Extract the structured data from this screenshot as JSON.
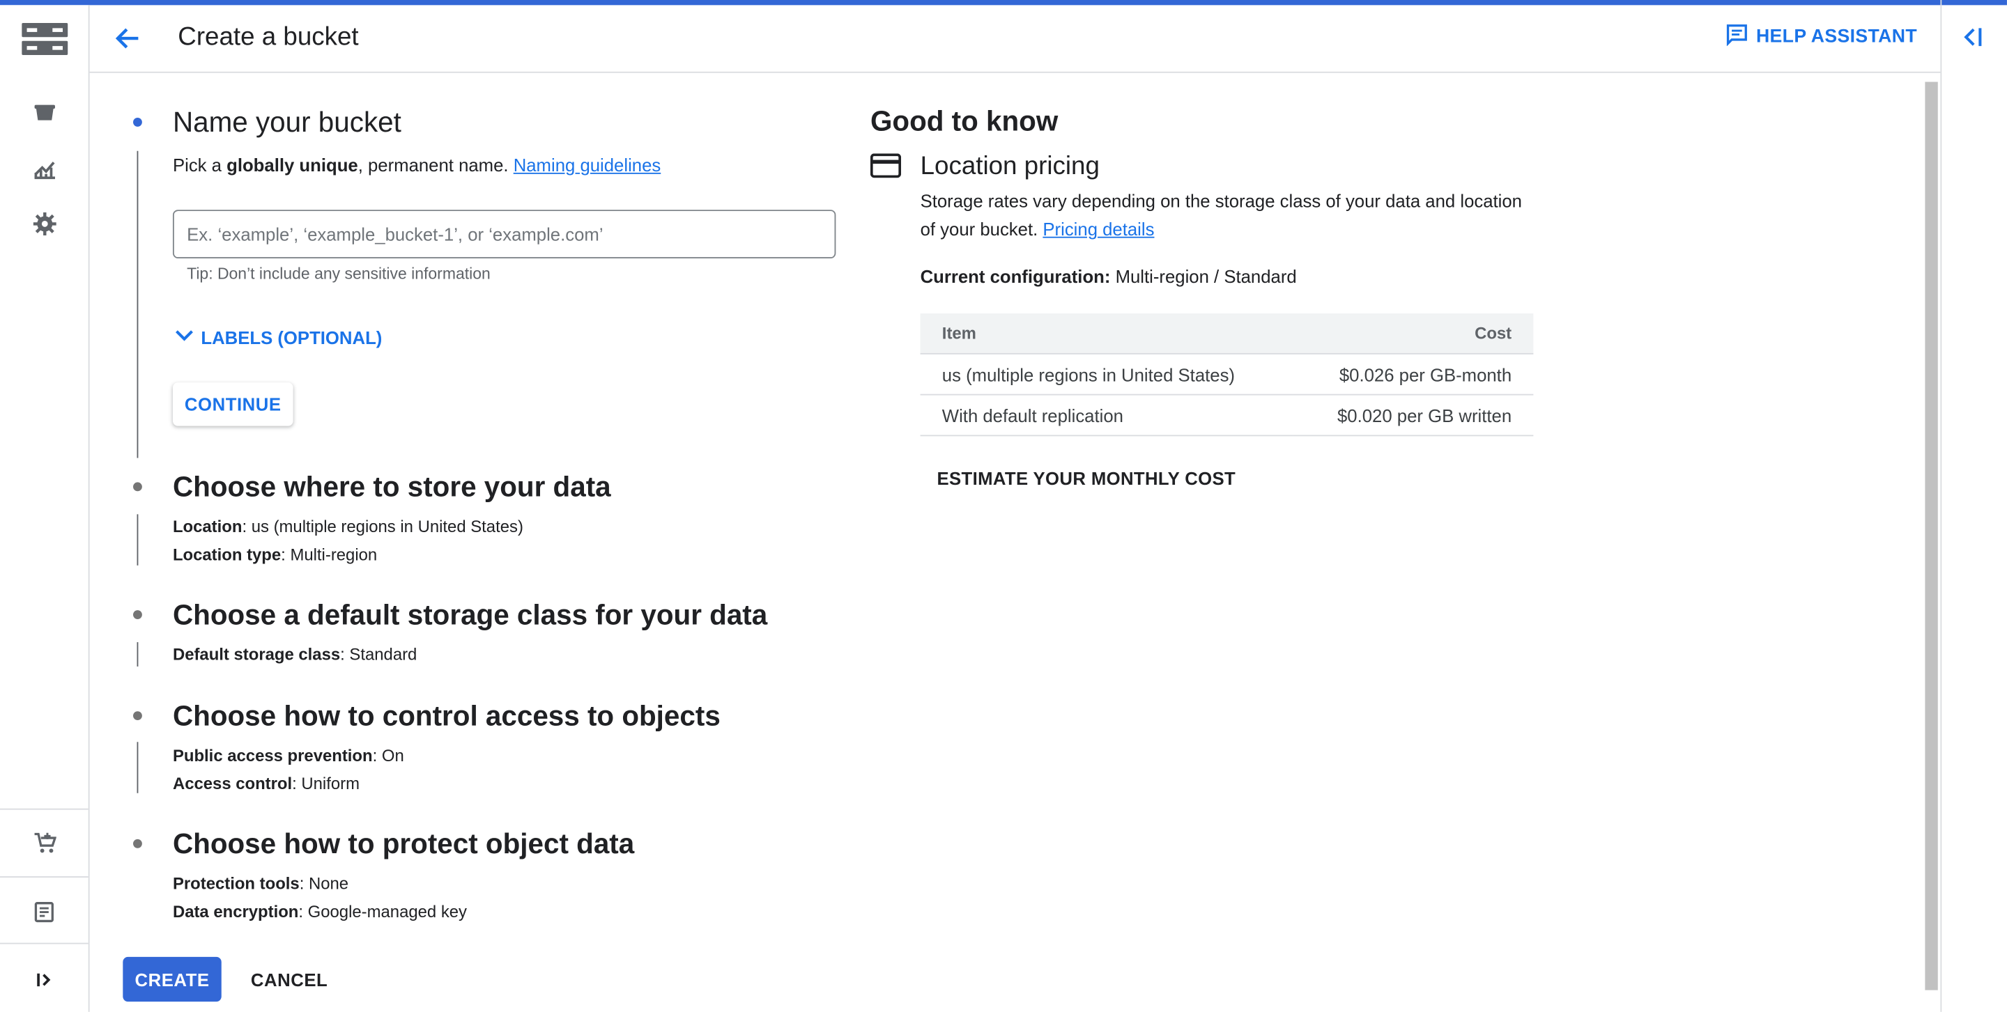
{
  "header": {
    "title": "Create a bucket",
    "help_label": "HELP ASSISTANT"
  },
  "nav": {
    "icons": [
      "storage-logo-icon",
      "bucket-icon",
      "monitoring-icon",
      "settings-icon",
      "marketplace-icon",
      "release-notes-icon",
      "expand-icon"
    ]
  },
  "steps": [
    {
      "title": "Name your bucket",
      "desc_prefix": "Pick a ",
      "desc_bold": "globally unique",
      "desc_suffix": ", permanent name. ",
      "desc_link": "Naming guidelines",
      "input_value": "",
      "input_placeholder": "Ex. ‘example’, ‘example_bucket-1’, or ‘example.com’",
      "tip": "Tip: Don’t include any sensitive information",
      "labels_toggle": "LABELS (OPTIONAL)",
      "continue_label": "CONTINUE"
    },
    {
      "title": "Choose where to store your data",
      "rows": [
        {
          "key": "Location",
          "value": ": us (multiple regions in United States)"
        },
        {
          "key": "Location type",
          "value": ": Multi-region"
        }
      ]
    },
    {
      "title": "Choose a default storage class for your data",
      "rows": [
        {
          "key": "Default storage class",
          "value": ": Standard"
        }
      ]
    },
    {
      "title": "Choose how to control access to objects",
      "rows": [
        {
          "key": "Public access prevention",
          "value": ": On"
        },
        {
          "key": "Access control",
          "value": ": Uniform"
        }
      ]
    },
    {
      "title": "Choose how to protect object data",
      "rows": [
        {
          "key": "Protection tools",
          "value": ": None"
        },
        {
          "key": "Data encryption",
          "value": ": Google-managed key"
        }
      ]
    }
  ],
  "actions": {
    "create_label": "CREATE",
    "cancel_label": "CANCEL"
  },
  "side": {
    "title": "Good to know",
    "pricing_title": "Location pricing",
    "pricing_desc": "Storage rates vary depending on the storage class of your data and location of your bucket. ",
    "pricing_link": "Pricing details",
    "config_label": "Current configuration:",
    "config_value": " Multi-region / Standard",
    "table": {
      "headers": [
        "Item",
        "Cost"
      ],
      "rows": [
        [
          "us (multiple regions in United States)",
          "$0.026 per GB-month"
        ],
        [
          "With default replication",
          "$0.020 per GB written"
        ]
      ]
    },
    "estimate_label": "ESTIMATE YOUR MONTHLY COST"
  },
  "colors": {
    "accent": "#1a73e8",
    "primary_button": "#3367d6",
    "top_bar": "#3367d6"
  }
}
